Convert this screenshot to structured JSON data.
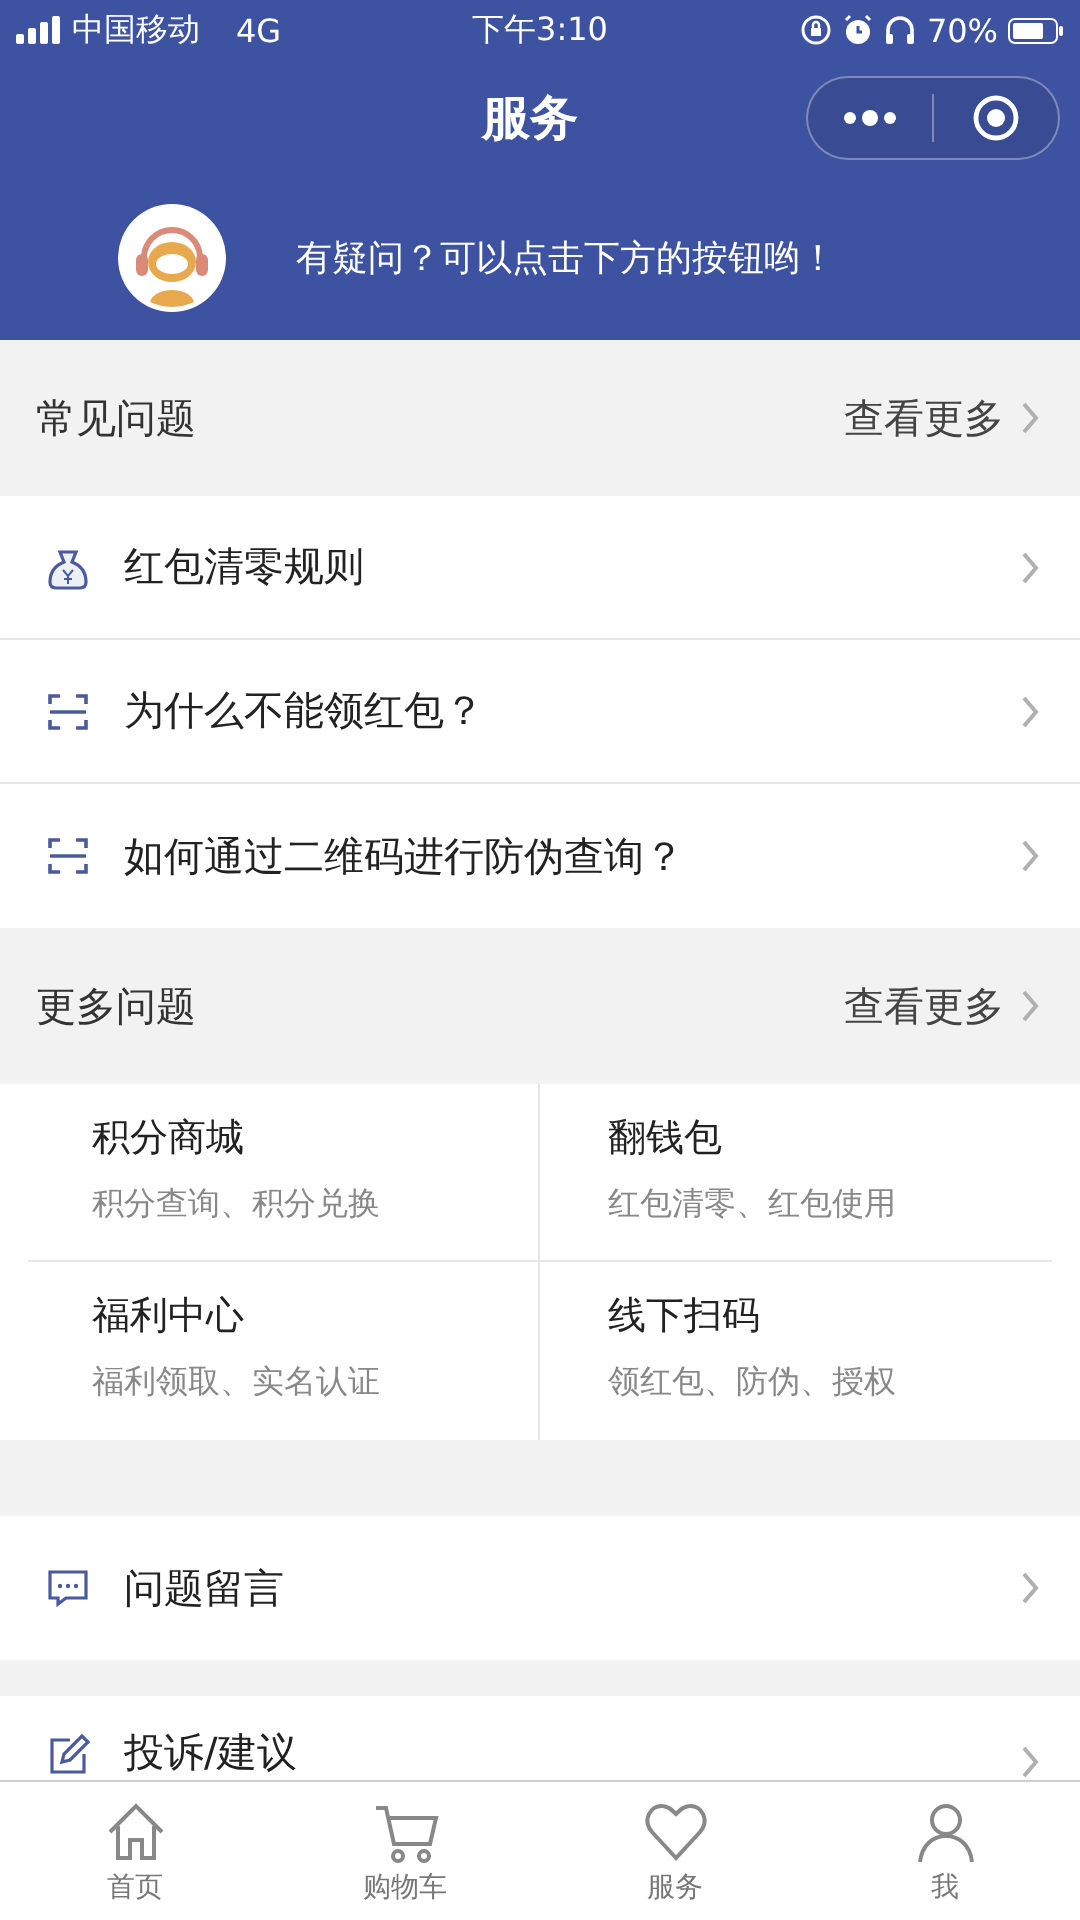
{
  "status_bar": {
    "carrier": "中国移动",
    "network": "4G",
    "time": "下午3:10",
    "battery": "70%"
  },
  "nav": {
    "title": "服务"
  },
  "banner": {
    "message": "有疑问？可以点击下方的按钮哟！"
  },
  "faq": {
    "title": "常见问题",
    "more": "查看更多",
    "items": [
      {
        "kind": "bag",
        "label": "红包清零规则"
      },
      {
        "kind": "scan",
        "label": "为什么不能领红包？"
      },
      {
        "kind": "scan",
        "label": "如何通过二维码进行防伪查询？"
      }
    ]
  },
  "more_questions": {
    "title": "更多问题",
    "more": "查看更多",
    "cards": [
      {
        "title": "积分商城",
        "subtitle": "积分查询、积分兑换"
      },
      {
        "title": "翻钱包",
        "subtitle": "红包清零、红包使用"
      },
      {
        "title": "福利中心",
        "subtitle": "福利领取、实名认证"
      },
      {
        "title": "线下扫码",
        "subtitle": "领红包、防伪、授权"
      }
    ]
  },
  "actions": [
    {
      "kind": "message",
      "label": "问题留言"
    },
    {
      "kind": "edit",
      "label": "投诉/建议"
    }
  ],
  "tab_bar": [
    {
      "kind": "home",
      "label": "首页",
      "selected": false
    },
    {
      "kind": "cart",
      "label": "购物车",
      "selected": false
    },
    {
      "kind": "heart",
      "label": "服务",
      "selected": false
    },
    {
      "kind": "person",
      "label": "我",
      "selected": false
    }
  ]
}
